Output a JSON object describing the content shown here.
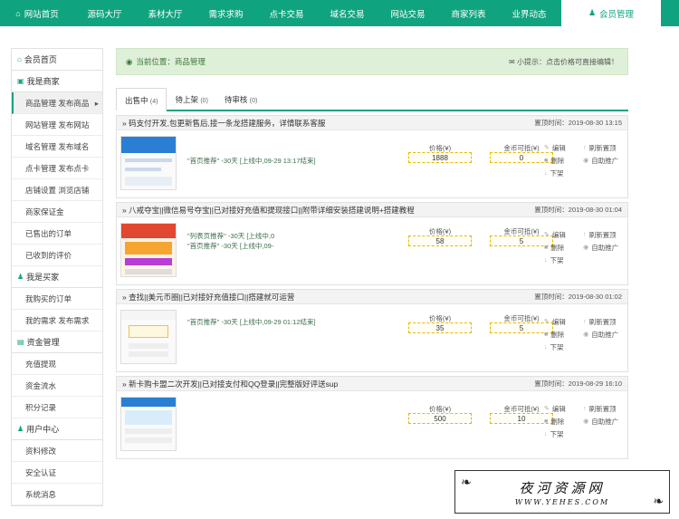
{
  "topnav": {
    "items": [
      "网站首页",
      "源码大厅",
      "素材大厅",
      "需求求购",
      "点卡交易",
      "域名交易",
      "网站交易",
      "商家列表",
      "业界动态"
    ],
    "active": "会员管理"
  },
  "sidebar": {
    "home": "会员首页",
    "groups": [
      {
        "title": "我是商家",
        "items": [
          "商品管理 发布商品",
          "网站管理 发布网站",
          "域名管理 发布域名",
          "点卡管理 发布点卡",
          "店铺设置 浏览店铺",
          "商家保证金",
          "已售出的订单",
          "已收到的评价"
        ]
      },
      {
        "title": "我是买家",
        "items": [
          "我购买的订单",
          "我的需求 发布需求"
        ]
      },
      {
        "title": "资金管理",
        "items": [
          "充值提现",
          "资金流水",
          "积分记录"
        ]
      },
      {
        "title": "用户中心",
        "items": [
          "资料修改",
          "安全认证",
          "系统消息"
        ]
      }
    ]
  },
  "location": {
    "text": "当前位置：商品管理",
    "tip": "小提示：点击价格可直接编辑！"
  },
  "tabs": [
    {
      "label": "出售中",
      "count": "(4)"
    },
    {
      "label": "待上架",
      "count": "(0)"
    },
    {
      "label": "待审核",
      "count": "(0)"
    }
  ],
  "labels": {
    "price": "价格(¥)",
    "coin": "金币可抵(¥)",
    "edit": "编辑",
    "refresh": "刷新置顶",
    "delete": "删除",
    "autopromo": "自助推广",
    "offline": "下架",
    "time_prefix": "置顶时间："
  },
  "products": [
    {
      "title": "» 码支付开发,包更新售后,接一条龙搭建服务，详情联系客服",
      "time": "置顶时间：2019-08-30 13:15",
      "promo": [
        "\"首页推荐\" -30天 [上线中,09-29 13:17结束]"
      ],
      "price": "1888",
      "coin": "0"
    },
    {
      "title": "» 八戒夺宝||微信易号夺宝||已对接好充值和提现接口||附带详细安装搭建说明+搭建教程",
      "time": "置顶时间：2019-08-30 01:04",
      "promo": [
        "\"列表页推荐\" -30天 [上线中,0",
        "\"首页推荐\" -30天 [上线中,09-"
      ],
      "price": "58",
      "coin": "5"
    },
    {
      "title": "» 查找||美元币圈||已对接好充值接口||搭建就可运营",
      "time": "置顶时间：2019-08-30 01:02",
      "promo": [
        "\"首页推荐\" -30天 [上线中,09-29 01:12结束]"
      ],
      "price": "35",
      "coin": "5"
    },
    {
      "title": "» 新卡购卡盟二次开发||已对接支付和QQ登录||完整版好评送sup",
      "time": "置顶时间：2019-08-29 16:10",
      "promo": [],
      "price": "500",
      "coin": "10"
    }
  ],
  "watermark": {
    "cn": "夜河资源网",
    "en": "WWW.YEHES.COM"
  },
  "colors": {
    "accent": "#10a37f",
    "location_bg": "#dff0d8"
  }
}
